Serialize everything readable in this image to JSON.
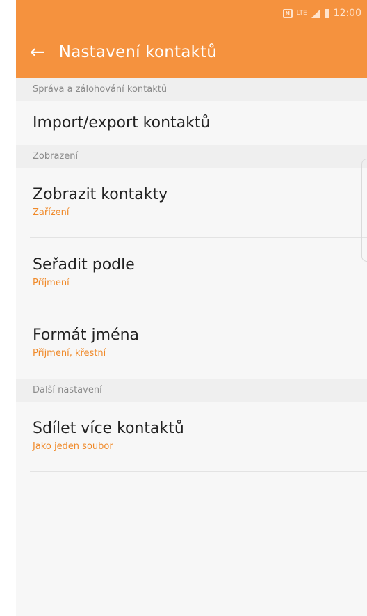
{
  "status_bar": {
    "time": "12:00",
    "nfc_label": "N",
    "network": "LTE",
    "icons": [
      "nfc-icon",
      "lte-icon",
      "signal-icon",
      "battery-icon"
    ]
  },
  "app_bar": {
    "back_icon": "arrow-left-icon",
    "title": "Nastavení kontaktů"
  },
  "sections": [
    {
      "header": "Správa a zálohování kontaktů",
      "items": [
        {
          "label": "Import/export kontaktů"
        }
      ]
    },
    {
      "header": "Zobrazení",
      "items": [
        {
          "label": "Zobrazit kontakty",
          "value": "Zařízení"
        },
        {
          "label": "Seřadit podle",
          "value": "Příjmení"
        },
        {
          "label": "Formát jména",
          "value": "Příjmení, křestní"
        }
      ]
    },
    {
      "header": "Další nastavení",
      "items": [
        {
          "label": "Sdílet více kontaktů",
          "value": "Jako jeden soubor"
        }
      ]
    }
  ],
  "colors": {
    "accent": "#f5923e",
    "subtitle": "#f08a2a",
    "background": "#f7f7f7",
    "section_header_bg": "#efefef"
  }
}
